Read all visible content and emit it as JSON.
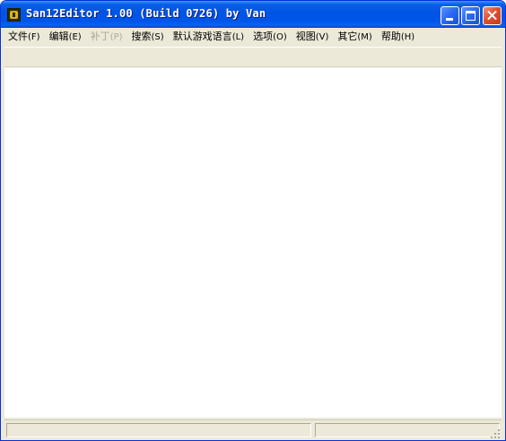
{
  "window": {
    "title": "San12Editor 1.00 (Build 0726) by Van",
    "icon": "app-icon"
  },
  "titlebar_buttons": {
    "minimize": "minimize-icon",
    "maximize": "maximize-icon",
    "close": "close-icon"
  },
  "menu": {
    "items": [
      {
        "label": "文件",
        "accel": "(F)",
        "enabled": true
      },
      {
        "label": "编辑",
        "accel": "(E)",
        "enabled": true
      },
      {
        "label": "补丁",
        "accel": "(P)",
        "enabled": false
      },
      {
        "label": "搜索",
        "accel": "(S)",
        "enabled": true
      },
      {
        "label": "默认游戏语言",
        "accel": "(L)",
        "enabled": true
      },
      {
        "label": "选项",
        "accel": "(O)",
        "enabled": true
      },
      {
        "label": "视图",
        "accel": "(V)",
        "enabled": true
      },
      {
        "label": "其它",
        "accel": "(M)",
        "enabled": true
      },
      {
        "label": "帮助",
        "accel": "(H)",
        "enabled": true
      }
    ]
  },
  "colors": {
    "titlebar": "#0054e3",
    "chrome": "#ece9d8",
    "client": "#ffffff",
    "disabled_text": "#aca899"
  }
}
